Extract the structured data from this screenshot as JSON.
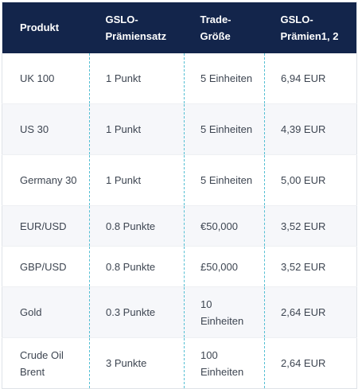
{
  "table": {
    "headers": [
      "Produkt",
      "GSLO-Prämiensatz",
      "Trade-Größe",
      "GSLO-Prämien1, 2"
    ],
    "header_lines": [
      [
        "Produkt"
      ],
      [
        "GSLO-",
        "Prämiensatz"
      ],
      [
        "Trade-",
        "Größe"
      ],
      [
        "GSLO-",
        "Prämien1, 2"
      ]
    ],
    "rows": [
      {
        "produkt": "UK 100",
        "satz": "1 Punkt",
        "groesse": "5 Einheiten",
        "praemie": "6,94 EUR"
      },
      {
        "produkt": "US 30",
        "satz": "1 Punkt",
        "groesse": "5 Einheiten",
        "praemie": "4,39 EUR"
      },
      {
        "produkt": "Germany 30",
        "satz": "1 Punkt",
        "groesse": "5 Einheiten",
        "praemie": "5,00 EUR"
      },
      {
        "produkt": "EUR/USD",
        "satz": "0.8 Punkte",
        "groesse": "€50,000",
        "praemie": "3,52 EUR"
      },
      {
        "produkt": "GBP/USD",
        "satz": "0.8 Punkte",
        "groesse": "£50,000",
        "praemie": "3,52 EUR"
      },
      {
        "produkt": "Gold",
        "satz": "0.3 Punkte",
        "groesse": "10 Einheiten",
        "praemie": "2,64 EUR"
      },
      {
        "produkt": "Crude Oil Brent",
        "satz": "3 Punkte",
        "groesse": "100 Einheiten",
        "praemie": "2,64 EUR"
      }
    ]
  },
  "colors": {
    "header_bg": "#13254b",
    "header_text": "#ffffff",
    "row_alt_bg": "#f6f7fa",
    "divider": "#55bfd3",
    "cell_text": "#3d4551"
  }
}
